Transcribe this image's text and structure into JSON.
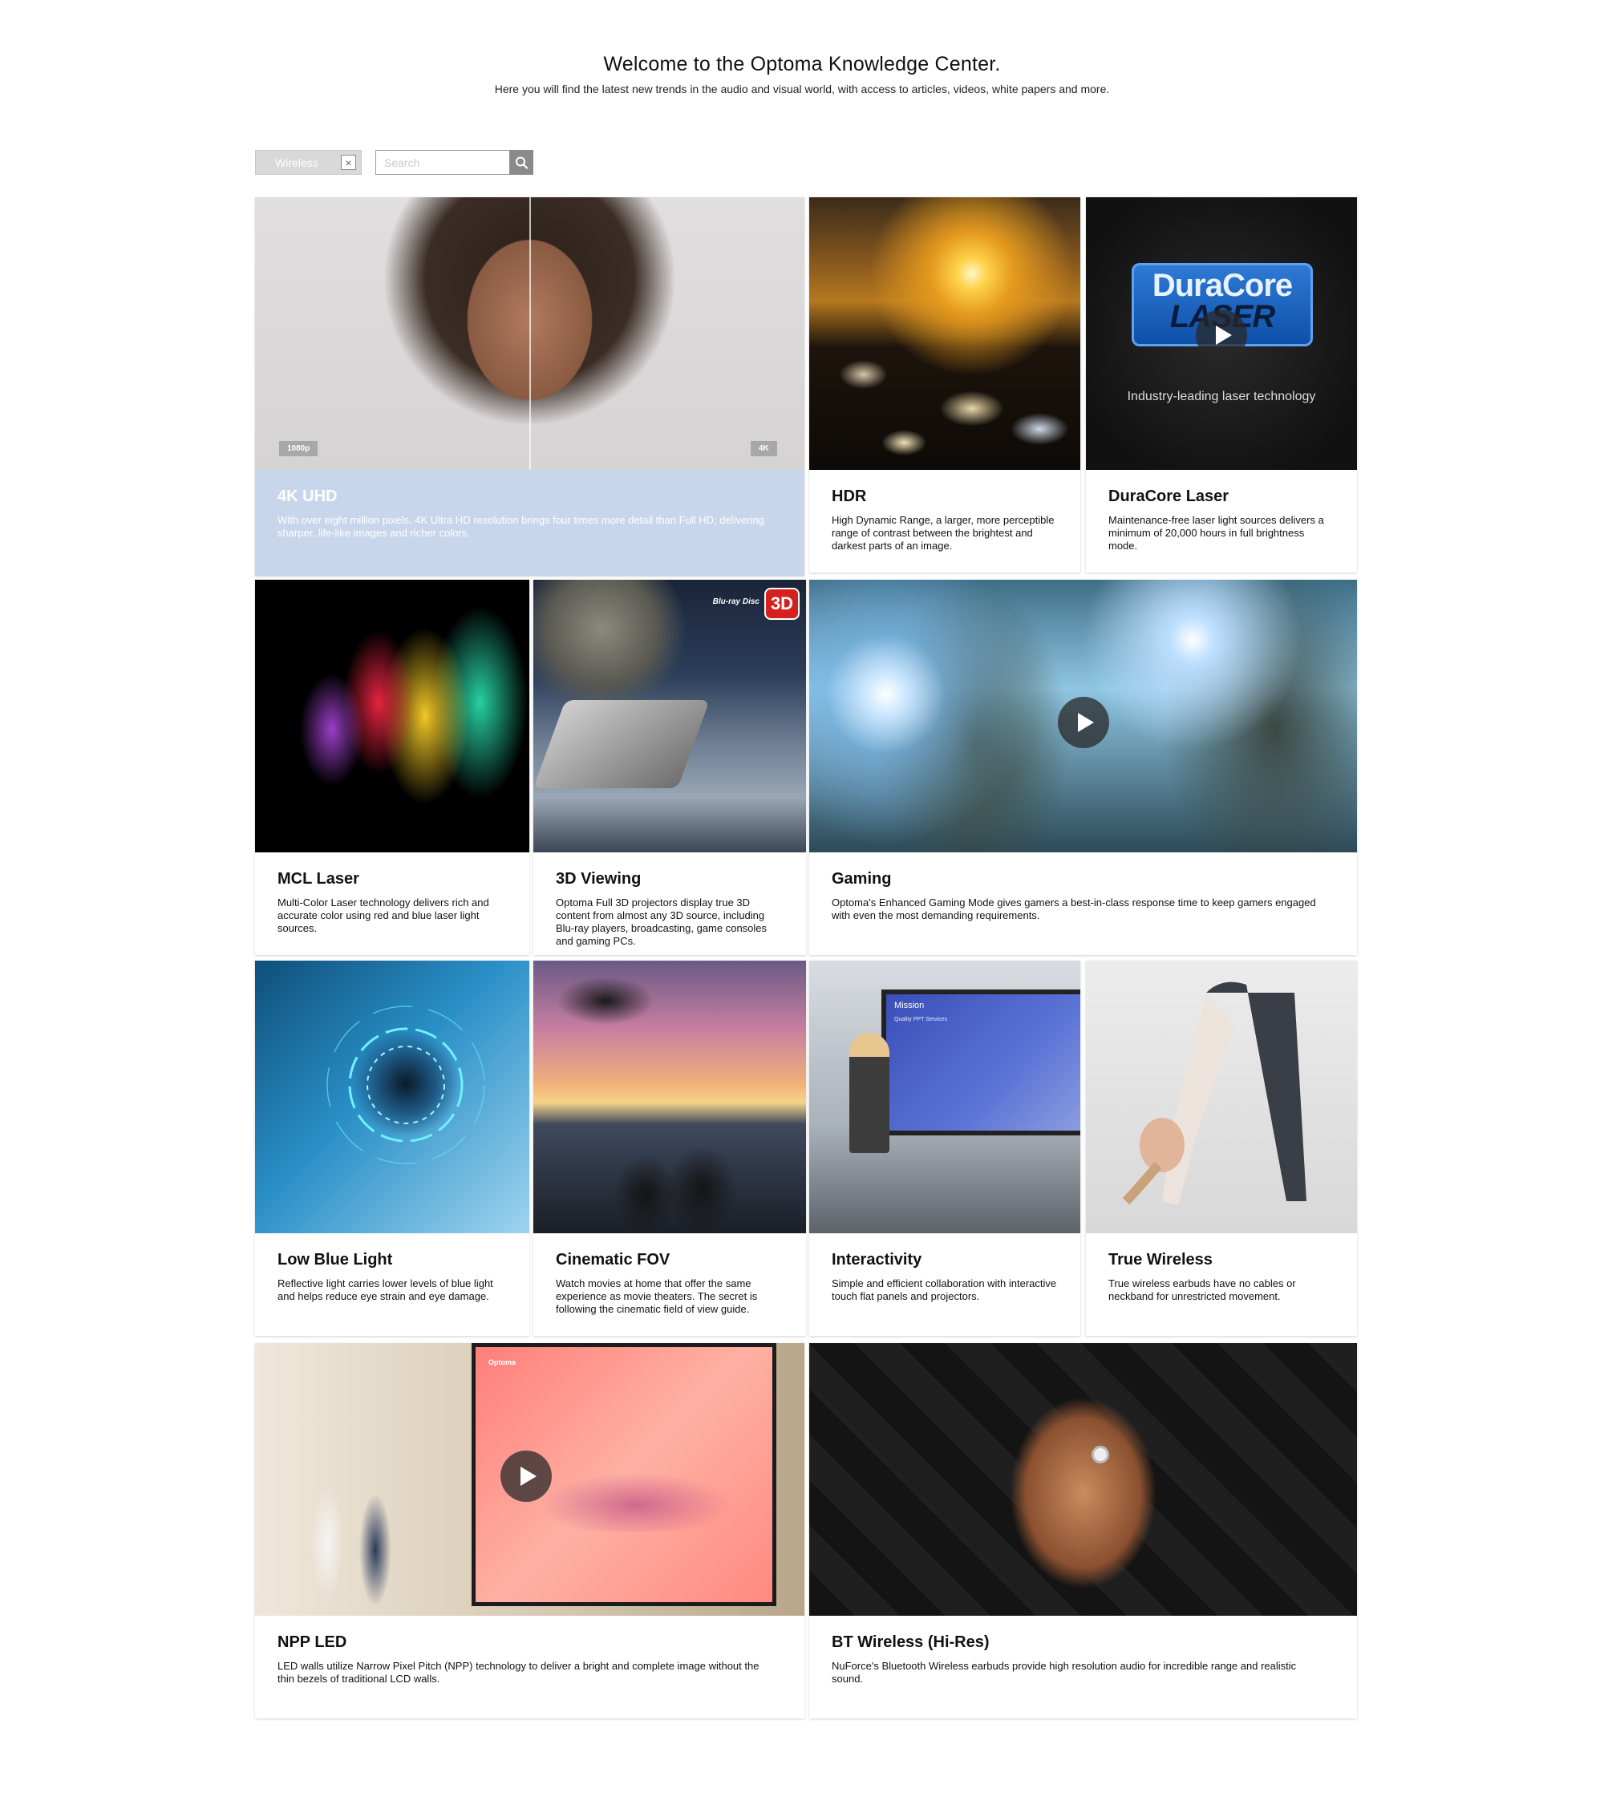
{
  "header": {
    "title": "Welcome to the Optoma Knowledge Center.",
    "subtitle": "Here you will find the latest new trends in the audio and visual world, with access to articles, videos, white papers and more."
  },
  "filters": {
    "active_tag": "Wireless",
    "search_placeholder": "Search"
  },
  "cards": {
    "uhd": {
      "title": "4K UHD",
      "desc": "With over eight million pixels, 4K Ultra HD resolution brings four times more detail than Full HD; delivering sharper, life-like images and richer colors.",
      "badge_left": "1080p",
      "badge_right": "4K"
    },
    "hdr": {
      "title": "HDR",
      "desc": "High Dynamic Range, a larger, more perceptible range of contrast between the brightest and darkest parts of an image."
    },
    "duracore": {
      "title": "DuraCore Laser",
      "desc": "Maintenance-free laser light sources delivers a minimum of 20,000 hours in full brightness mode.",
      "logo_top": "DuraCore",
      "logo_bottom": "LASER",
      "caption": "Industry-leading laser technology"
    },
    "mcl": {
      "title": "MCL Laser",
      "desc": "Multi-Color Laser technology delivers rich and accurate color using red and blue laser light sources."
    },
    "viewing3d": {
      "title": "3D Viewing",
      "desc": "Optoma Full 3D projectors display true 3D content from almost any 3D source, including Blu-ray players, broadcasting, game consoles and gaming PCs.",
      "logo_bluray": "Blu-ray Disc",
      "logo_3d": "3D"
    },
    "gaming": {
      "title": "Gaming",
      "desc": "Optoma's Enhanced Gaming Mode gives gamers a best-in-class response time to keep gamers engaged with even the most demanding requirements."
    },
    "lowblue": {
      "title": "Low Blue Light",
      "desc": "Reflective light carries lower levels of blue light and helps reduce eye strain and eye damage."
    },
    "cinematic": {
      "title": "Cinematic FOV",
      "desc": "Watch movies at home that offer the same experience as movie theaters. The secret is following the cinematic field of view guide."
    },
    "interactivity": {
      "title": "Interactivity",
      "desc": "Simple and efficient collaboration with interactive touch flat panels and projectors.",
      "screen_title": "Mission",
      "screen_subtitle": "Quality PPT Services"
    },
    "truewireless": {
      "title": "True Wireless",
      "desc": "True wireless earbuds have no cables or neckband for unrestricted movement."
    },
    "npp": {
      "title": "NPP LED",
      "desc": "LED walls utilize Narrow Pixel Pitch (NPP) technology to deliver a bright and complete image without the thin bezels of traditional LCD walls.",
      "screen_logo": "Optoma"
    },
    "btwireless": {
      "title": "BT Wireless (Hi-Res)",
      "desc": "NuForce's Bluetooth Wireless earbuds provide high resolution audio for incredible range and realistic sound."
    }
  },
  "colors": {
    "feature_panel": "#c8d6ec",
    "tag_bg": "#d9d9d9",
    "search_button": "#8a8a8a"
  },
  "icons": {
    "tag_remove": "close-icon",
    "search": "search-icon",
    "video": "play-icon"
  }
}
